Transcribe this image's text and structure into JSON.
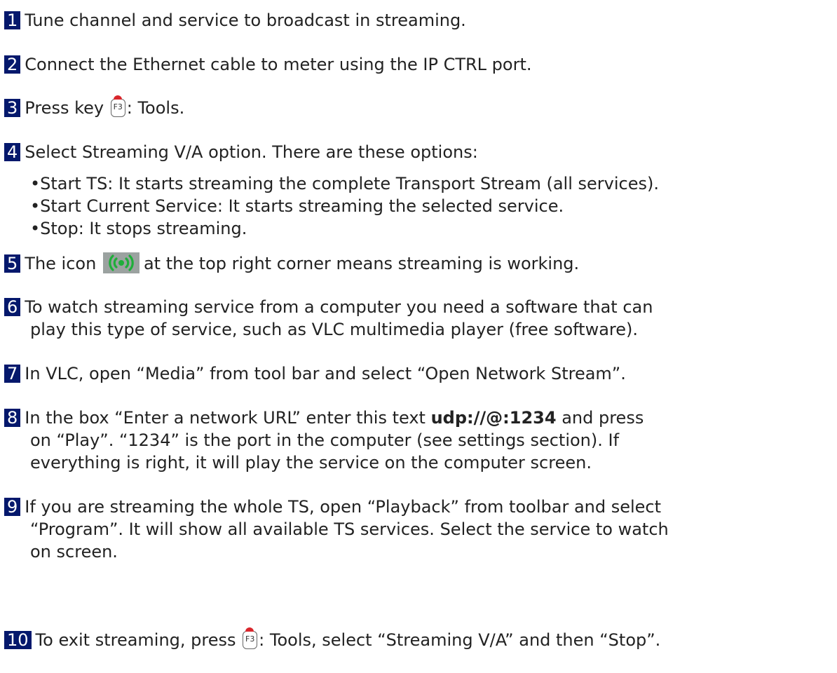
{
  "steps": [
    {
      "num": "1",
      "text": "Tune channel and service to broadcast in streaming."
    },
    {
      "num": "2",
      "text": "Connect the Ethernet cable to meter using the IP CTRL port."
    },
    {
      "num": "3",
      "pre": "Press key",
      "key": "F3",
      "post": ": Tools."
    },
    {
      "num": "4",
      "text": "Select Streaming V/A option. There are these options:",
      "bullets": [
        "•Start TS: It starts streaming the complete Transport Stream (all services).",
        "•Start Current Service: It starts streaming the selected service.",
        "•Stop: It stops streaming."
      ]
    },
    {
      "num": "5",
      "pre": "The icon",
      "post": "at the top right corner means streaming is working."
    },
    {
      "num": "6",
      "line1": "To watch streaming service from a computer you need a software that can",
      "line2": "play this type of service, such as VLC multimedia player (free software)."
    },
    {
      "num": "7",
      "text": "In VLC, open “Media” from tool bar and select “Open Network Stream”."
    },
    {
      "num": "8",
      "pre": "In the box “Enter a network URL” enter this text",
      "bold": "udp://@:1234",
      "post": "and press",
      "line2": "on “Play”. “1234” is the port in the computer (see settings section). If",
      "line3": "everything is right, it will play the service on the computer screen."
    },
    {
      "num": "9",
      "line1": "If you are streaming the whole TS, open “Playback” from toolbar and select",
      "line2": "“Program”. It will show all available TS services. Select the service to watch",
      "line3": "on screen."
    },
    {
      "num": "10",
      "pre": "To exit streaming, press",
      "key": "F3",
      "post": ": Tools, select “Streaming V/A” and then “Stop”."
    }
  ],
  "colors": {
    "badge": "#04186c",
    "icon_bg": "#9ba2a0",
    "icon_fg": "#1fae3a",
    "key_nub": "#d9262c"
  }
}
